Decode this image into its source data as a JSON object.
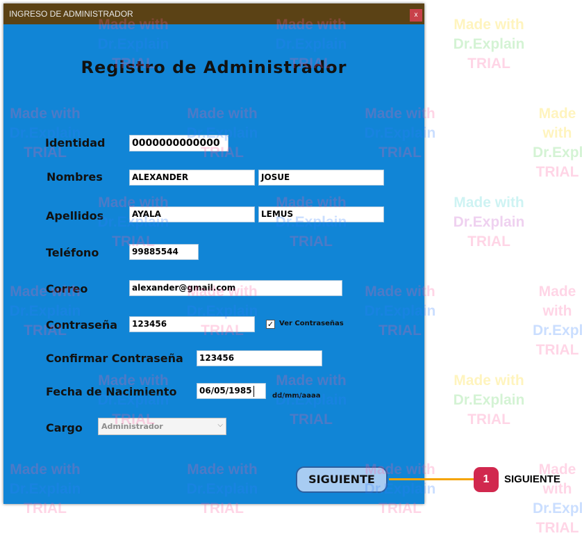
{
  "window": {
    "title": "INGRESO DE ADMINISTRADOR",
    "close_glyph": "x",
    "heading": "Registro de Administrador"
  },
  "form": {
    "identidad": {
      "label": "Identidad",
      "value": "0000000000000"
    },
    "nombres": {
      "label": "Nombres",
      "first": "ALEXANDER",
      "second": "JOSUE"
    },
    "apellidos": {
      "label": "Apellidos",
      "first": "AYALA",
      "second": "LEMUS"
    },
    "telefono": {
      "label": "Teléfono",
      "value": "99885544"
    },
    "correo": {
      "label": "Correo",
      "value": "alexander@gmail.com"
    },
    "contrasena": {
      "label": "Contraseña",
      "value": "123456"
    },
    "ver_contrasenas": {
      "label": "Ver Contraseñas",
      "checked": true,
      "glyph": "✓"
    },
    "confirmar": {
      "label": "Confirmar Contraseña",
      "value": "123456"
    },
    "fecha": {
      "label": "Fecha de Nacimiento",
      "value": "06/05/1985",
      "hint": "dd/mm/aaaa"
    },
    "cargo": {
      "label": "Cargo",
      "selected": "Administrador",
      "arrow_icon": "chevron-down-icon"
    },
    "submit_label": "SIGUIENTE"
  },
  "callout": {
    "number": "1",
    "label": "SIGUIENTE",
    "badge_color": "#d1284e",
    "line_color": "#f5a400"
  },
  "watermark": {
    "line1": "Made with",
    "line2": "Dr.Explain",
    "line3": "TRIAL"
  },
  "colors": {
    "window_bg": "#1185d6",
    "titlebar_bg": "#5b4215",
    "button_bg": "#a8ccf2"
  }
}
